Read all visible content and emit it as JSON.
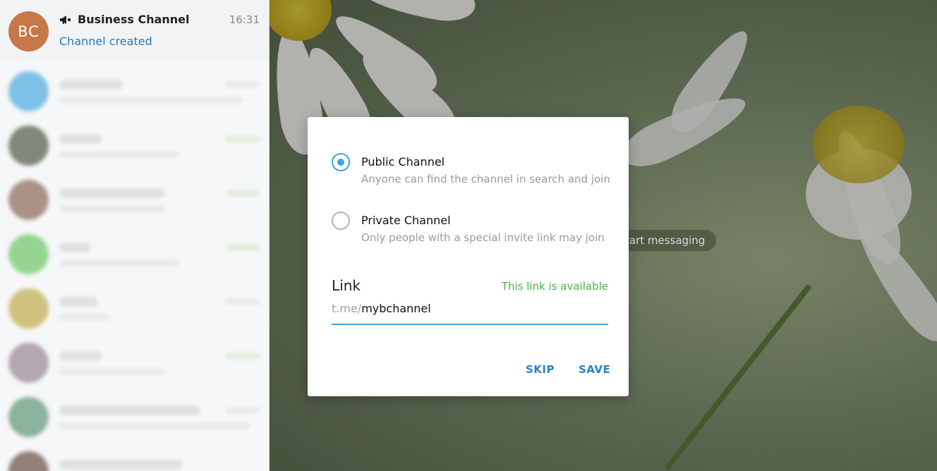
{
  "sidebar": {
    "active_chat": {
      "avatar_initials": "BC",
      "title": "Business Channel",
      "time": "16:31",
      "subtitle": "Channel created",
      "icon": "megaphone-icon"
    }
  },
  "chat_area": {
    "placeholder_text": "tart messaging"
  },
  "dialog": {
    "options": [
      {
        "label": "Public Channel",
        "description": "Anyone can find the channel in search and join",
        "selected": true
      },
      {
        "label": "Private Channel",
        "description": "Only people with a special invite link may join",
        "selected": false
      }
    ],
    "link": {
      "label": "Link",
      "status": "This link is available",
      "prefix": "t.me/",
      "value": "mybchannel"
    },
    "buttons": {
      "skip": "SKIP",
      "save": "SAVE"
    }
  },
  "colors": {
    "accent": "#3aa4e0",
    "link_button": "#2a82c8",
    "available": "#4caf50",
    "avatar_bc": "#c8774a"
  }
}
